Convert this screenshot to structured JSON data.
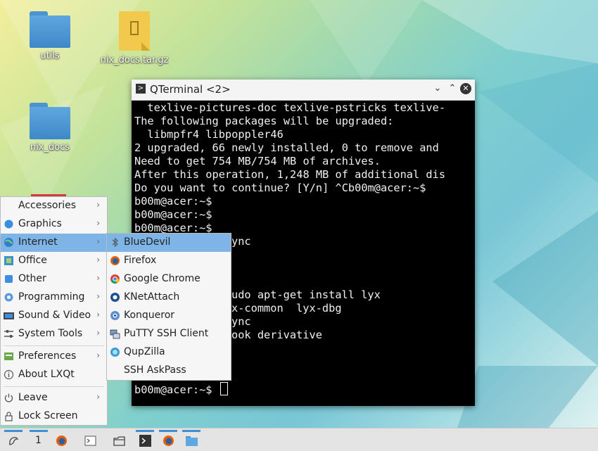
{
  "desktop": {
    "icons": [
      {
        "label": "utils",
        "icon": "folder-icon"
      },
      {
        "label": "nix_docs.tar.gz",
        "icon": "archive-icon"
      },
      {
        "label": "nix_docs",
        "icon": "folder-icon"
      }
    ]
  },
  "terminal": {
    "title": "QTerminal <2>",
    "lines": [
      "  texlive-pictures-doc texlive-pstricks texlive-",
      "The following packages will be upgraded:",
      "  libmpfr4 libpoppler46",
      "2 upgraded, 66 newly installed, 0 to remove and",
      "Need to get 754 MB/754 MB of archives.",
      "After this operation, 1,248 MB of additional dis",
      "Do you want to continue? [Y/n] ^Cb00m@acer:~$",
      "b00m@acer:~$",
      "b00m@acer:~$",
      "b00m@acer:~$",
      "ync",
      "udo apt-get install lyx",
      "x-common  lyx-dbg",
      "ync",
      "ook derivative"
    ],
    "prompt": "b00m@acer:~$ "
  },
  "menu": {
    "items": [
      {
        "label": "Accessories",
        "icon": "accessories-icon",
        "arrow": "›"
      },
      {
        "label": "Graphics",
        "icon": "graphics-icon",
        "arrow": "›"
      },
      {
        "label": "Internet",
        "icon": "internet-icon",
        "arrow": "›"
      },
      {
        "label": "Office",
        "icon": "office-icon",
        "arrow": "›"
      },
      {
        "label": "Other",
        "icon": "other-icon",
        "arrow": "›"
      },
      {
        "label": "Programming",
        "icon": "programming-icon",
        "arrow": "›"
      },
      {
        "label": "Sound & Video",
        "icon": "sound-video-icon",
        "arrow": "›"
      },
      {
        "label": "System Tools",
        "icon": "system-tools-icon",
        "arrow": "›"
      },
      {
        "label": "Preferences",
        "icon": "preferences-icon",
        "arrow": "›"
      },
      {
        "label": "About LXQt",
        "icon": "info-icon",
        "arrow": ""
      },
      {
        "label": "Leave",
        "icon": "power-icon",
        "arrow": "›"
      },
      {
        "label": "Lock Screen",
        "icon": "lock-icon",
        "arrow": ""
      }
    ],
    "active": "Internet"
  },
  "submenu": {
    "items": [
      {
        "label": "BlueDevil",
        "icon": "bluetooth-icon"
      },
      {
        "label": "Firefox",
        "icon": "firefox-icon"
      },
      {
        "label": "Google Chrome",
        "icon": "chrome-icon"
      },
      {
        "label": "KNetAttach",
        "icon": "knetattach-icon"
      },
      {
        "label": "Konqueror",
        "icon": "konqueror-icon"
      },
      {
        "label": "PuTTY SSH Client",
        "icon": "putty-icon"
      },
      {
        "label": "QupZilla",
        "icon": "qupzilla-icon"
      },
      {
        "label": "SSH AskPass",
        "icon": ""
      }
    ],
    "active": "BlueDevil"
  },
  "taskbar": {
    "workspace": "1",
    "buttons": [
      "lxqt-menu-icon",
      "firefox-icon",
      "terminal-icon",
      "file-manager-icon",
      "qterminal-icon",
      "firefox-icon",
      "folder-icon"
    ]
  },
  "colors": {
    "accent": "#3d8fd6",
    "highlight": "#7fb4e6",
    "terminal_bg": "#000000"
  }
}
